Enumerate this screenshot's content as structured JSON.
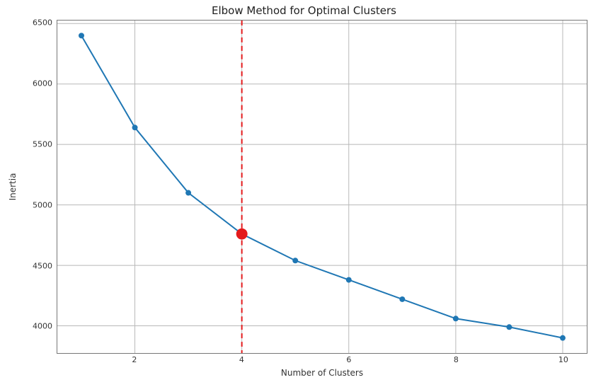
{
  "chart_data": {
    "type": "line",
    "title": "Elbow Method for Optimal Clusters",
    "xlabel": "Number of Clusters",
    "ylabel": "Inertia",
    "x": [
      1,
      2,
      3,
      4,
      5,
      6,
      7,
      8,
      9,
      10
    ],
    "values": [
      6400,
      5640,
      5100,
      4760,
      4540,
      4380,
      4220,
      4060,
      3990,
      3900
    ],
    "xlim": [
      0.55,
      10.45
    ],
    "ylim": [
      3775,
      6525
    ],
    "x_ticks": [
      2,
      4,
      6,
      8,
      10
    ],
    "y_ticks": [
      4000,
      4500,
      5000,
      5500,
      6000,
      6500
    ],
    "grid": true,
    "highlight": {
      "x": 4,
      "y": 4760,
      "vline_x": 4
    },
    "colors": {
      "line": "#1f77b4",
      "marker": "#1f77b4",
      "highlight": "#e41a1c",
      "vline": "#e41a1c"
    }
  }
}
